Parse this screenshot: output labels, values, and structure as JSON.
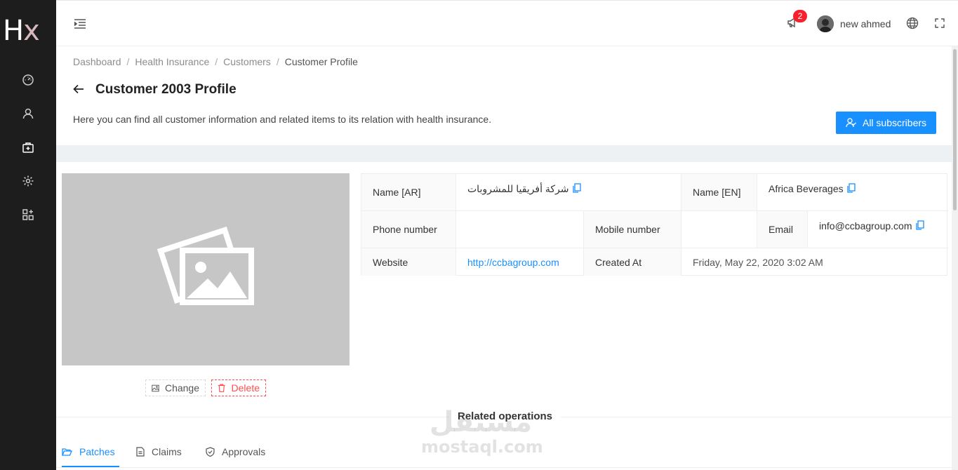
{
  "brand": {
    "logo_h": "H",
    "logo_x": "x"
  },
  "sidebar": {
    "items": [
      {
        "icon": "dashboard-icon"
      },
      {
        "icon": "user-icon"
      },
      {
        "icon": "medical-kit-icon"
      },
      {
        "icon": "gear-icon"
      },
      {
        "icon": "apps-icon"
      }
    ]
  },
  "topbar": {
    "notification_count": "2",
    "username": "new ahmed"
  },
  "breadcrumb": [
    "Dashboard",
    "Health Insurance",
    "Customers",
    "Customer Profile"
  ],
  "header": {
    "title": "Customer 2003 Profile",
    "description": "Here you can find all customer information and related items to its relation with health insurance.",
    "all_subscribers_label": "All subscribers"
  },
  "image_actions": {
    "change_label": "Change",
    "delete_label": "Delete"
  },
  "customer": {
    "name_ar_label": "Name [AR]",
    "name_ar": "شركة أفريقيا للمشروبات",
    "name_en_label": "Name [EN]",
    "name_en": "Africa Beverages",
    "phone_label": "Phone number",
    "phone": "",
    "mobile_label": "Mobile number",
    "mobile": "",
    "email_label": "Email",
    "email": "info@ccbagroup.com",
    "website_label": "Website",
    "website": "http://ccbagroup.com",
    "created_label": "Created At",
    "created_at": "Friday, May 22, 2020 3:02 AM"
  },
  "related": {
    "title": "Related operations",
    "tabs": [
      {
        "label": "Patches",
        "icon": "folder-open-icon",
        "active": true
      },
      {
        "label": "Claims",
        "icon": "file-text-icon",
        "active": false
      },
      {
        "label": "Approvals",
        "icon": "shield-check-icon",
        "active": false
      }
    ]
  },
  "watermark": {
    "arabic": "مستقل",
    "latin": "mostaql.com"
  },
  "colors": {
    "primary": "#1890ff",
    "danger": "#ff4d4f",
    "sidebar": "#1d1d1d",
    "badge": "#f5222d"
  }
}
